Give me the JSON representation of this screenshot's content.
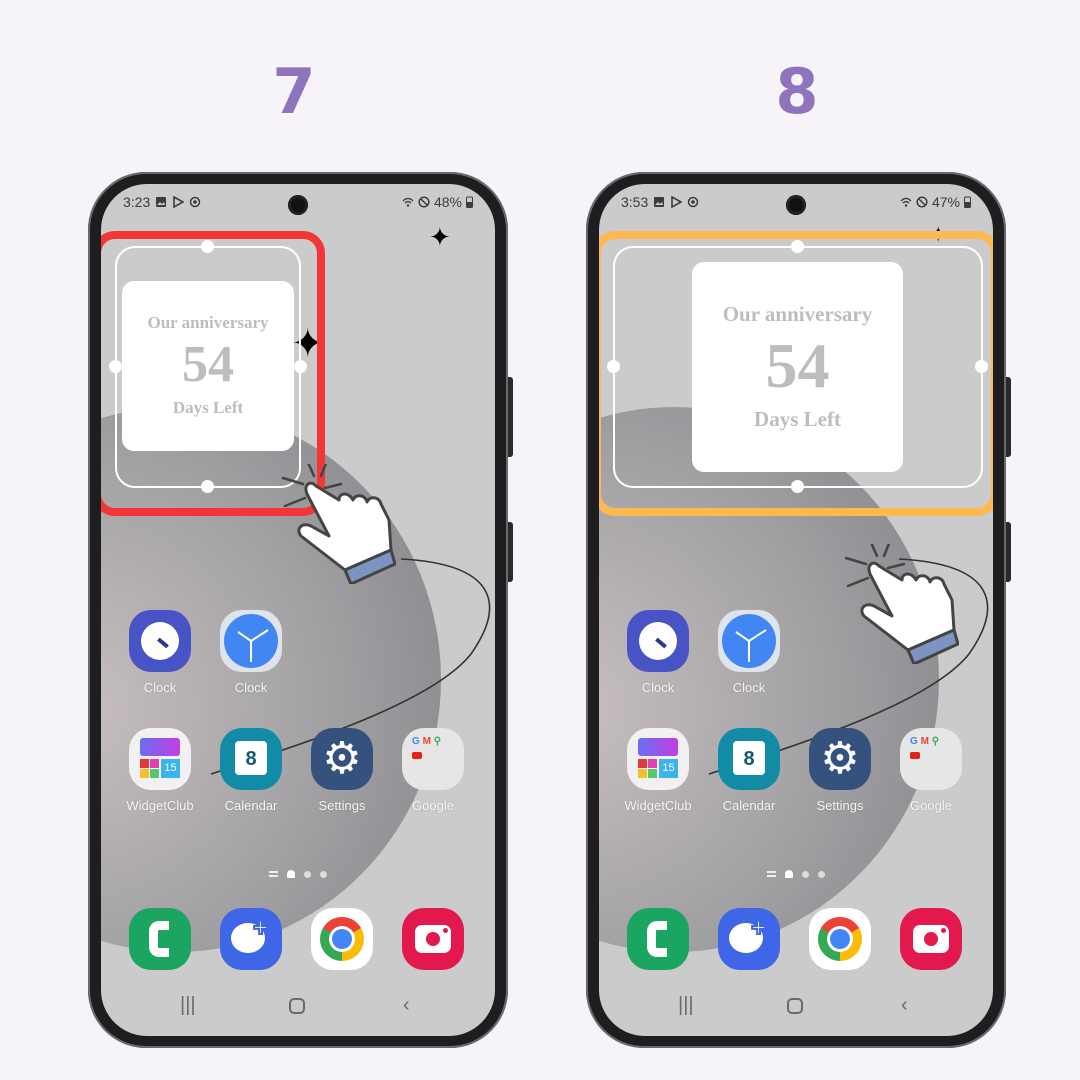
{
  "steps": [
    {
      "number": "7",
      "status_time": "3:23",
      "battery": "48%",
      "highlight_color": "#f23535",
      "widget": {
        "title": "Our anniversary",
        "count": "54",
        "subtitle": "Days Left"
      }
    },
    {
      "number": "8",
      "status_time": "3:53",
      "battery": "47%",
      "highlight_color": "#fdb94f",
      "widget": {
        "title": "Our anniversary",
        "count": "54",
        "subtitle": "Days Left"
      }
    }
  ],
  "apps_row1": [
    {
      "label": "Clock",
      "icon": "samsung-clock-icon"
    },
    {
      "label": "Clock",
      "icon": "google-clock-icon"
    }
  ],
  "apps_row2": [
    {
      "label": "WidgetClub",
      "icon": "widgetclub-icon"
    },
    {
      "label": "Calendar",
      "icon": "calendar-icon",
      "badge": "8"
    },
    {
      "label": "Settings",
      "icon": "gear-icon"
    },
    {
      "label": "Google",
      "icon": "google-folder-icon"
    }
  ],
  "dock": [
    {
      "icon": "phone-icon"
    },
    {
      "icon": "messages-icon"
    },
    {
      "icon": "chrome-icon"
    },
    {
      "icon": "camera-icon"
    }
  ],
  "colors": {
    "step_number": "#8f73bd",
    "background": "#f6f4f8"
  }
}
